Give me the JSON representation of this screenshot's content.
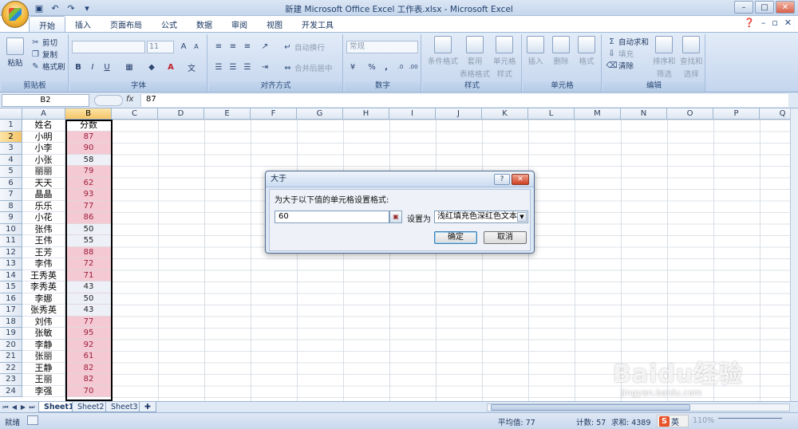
{
  "window": {
    "title": "新建 Microsoft Office Excel 工作表.xlsx - Microsoft Excel",
    "controls": [
      "–",
      "□",
      "✕"
    ]
  },
  "tabs": [
    "开始",
    "插入",
    "页面布局",
    "公式",
    "数据",
    "审阅",
    "视图",
    "开发工具"
  ],
  "ribbon": {
    "clipboard": {
      "paste": "粘贴",
      "cut": "剪切",
      "copy": "复制",
      "format_painter": "格式刷",
      "label": "剪贴板"
    },
    "font": {
      "size": "11",
      "bold": "B",
      "italic": "I",
      "underline": "U",
      "font_color": "A",
      "label": "字体"
    },
    "alignment": {
      "wrap": "自动换行",
      "merge": "合并后居中",
      "label": "对齐方式"
    },
    "number": {
      "format": "常规",
      "percent": "%",
      "comma": ",",
      "label": "数字"
    },
    "styles": {
      "conditional": "条件格式",
      "table_format_1": "套用",
      "table_format_2": "表格格式",
      "cell_style_1": "单元格",
      "cell_style_2": "样式",
      "label": "样式"
    },
    "cells": {
      "insert": "插入",
      "delete": "删除",
      "format": "格式",
      "label": "单元格"
    },
    "editing": {
      "autosum": "自动求和",
      "fill": "填充",
      "clear": "清除",
      "sort_1": "排序和",
      "sort_2": "筛选",
      "find_1": "查找和",
      "find_2": "选择",
      "label": "编辑"
    }
  },
  "formula_bar": {
    "name_box": "B2",
    "fx": "fx",
    "value": "87"
  },
  "columns": [
    "A",
    "B",
    "C",
    "D",
    "E",
    "F",
    "G",
    "H",
    "I",
    "J",
    "K",
    "L",
    "M",
    "N",
    "O",
    "P",
    "Q"
  ],
  "rows": [
    {
      "n": "1",
      "name": "姓名",
      "score": "分数",
      "hl": false,
      "header": true
    },
    {
      "n": "2",
      "name": "小明",
      "score": "87",
      "hl": true
    },
    {
      "n": "3",
      "name": "小李",
      "score": "90",
      "hl": true
    },
    {
      "n": "4",
      "name": "小张",
      "score": "58",
      "hl": false
    },
    {
      "n": "5",
      "name": "丽丽",
      "score": "79",
      "hl": true
    },
    {
      "n": "6",
      "name": "天天",
      "score": "62",
      "hl": true
    },
    {
      "n": "7",
      "name": "晶晶",
      "score": "93",
      "hl": true
    },
    {
      "n": "8",
      "name": "乐乐",
      "score": "77",
      "hl": true
    },
    {
      "n": "9",
      "name": "小花",
      "score": "86",
      "hl": true
    },
    {
      "n": "10",
      "name": "张伟",
      "score": "50",
      "hl": false
    },
    {
      "n": "11",
      "name": "王伟",
      "score": "55",
      "hl": false
    },
    {
      "n": "12",
      "name": "王芳",
      "score": "88",
      "hl": true
    },
    {
      "n": "13",
      "name": "李伟",
      "score": "72",
      "hl": true
    },
    {
      "n": "14",
      "name": "王秀英",
      "score": "71",
      "hl": true
    },
    {
      "n": "15",
      "name": "李秀英",
      "score": "43",
      "hl": false
    },
    {
      "n": "16",
      "name": "李娜",
      "score": "50",
      "hl": false
    },
    {
      "n": "17",
      "name": "张秀英",
      "score": "43",
      "hl": false
    },
    {
      "n": "18",
      "name": "刘伟",
      "score": "77",
      "hl": true
    },
    {
      "n": "19",
      "name": "张敏",
      "score": "95",
      "hl": true
    },
    {
      "n": "20",
      "name": "李静",
      "score": "92",
      "hl": true
    },
    {
      "n": "21",
      "name": "张丽",
      "score": "61",
      "hl": true
    },
    {
      "n": "22",
      "name": "王静",
      "score": "82",
      "hl": true
    },
    {
      "n": "23",
      "name": "王丽",
      "score": "82",
      "hl": true
    },
    {
      "n": "24",
      "name": "李强",
      "score": "70",
      "hl": true
    }
  ],
  "sheets": [
    "Sheet1",
    "Sheet2",
    "Sheet3"
  ],
  "status": {
    "mode": "就绪",
    "average": "平均值: 77",
    "count": "计数: 57",
    "sum": "求和: 4389",
    "zoom": "110%",
    "ime": "英"
  },
  "dialog": {
    "title": "大于",
    "prompt": "为大于以下值的单元格设置格式:",
    "value": "60",
    "set_label": "设置为",
    "format_option": "浅红填充色深红色文本",
    "ok": "确定",
    "cancel": "取消",
    "help": "?",
    "close": "✕"
  },
  "watermark": {
    "line1": "Baidu经验",
    "line2": "jingyan.baidu.com"
  },
  "colors": {
    "highlight_fill": "#f4c9d3",
    "highlight_text": "#9c1c3a",
    "ribbon_bg": "#cbdaf0",
    "selected_header": "#f5c468"
  }
}
